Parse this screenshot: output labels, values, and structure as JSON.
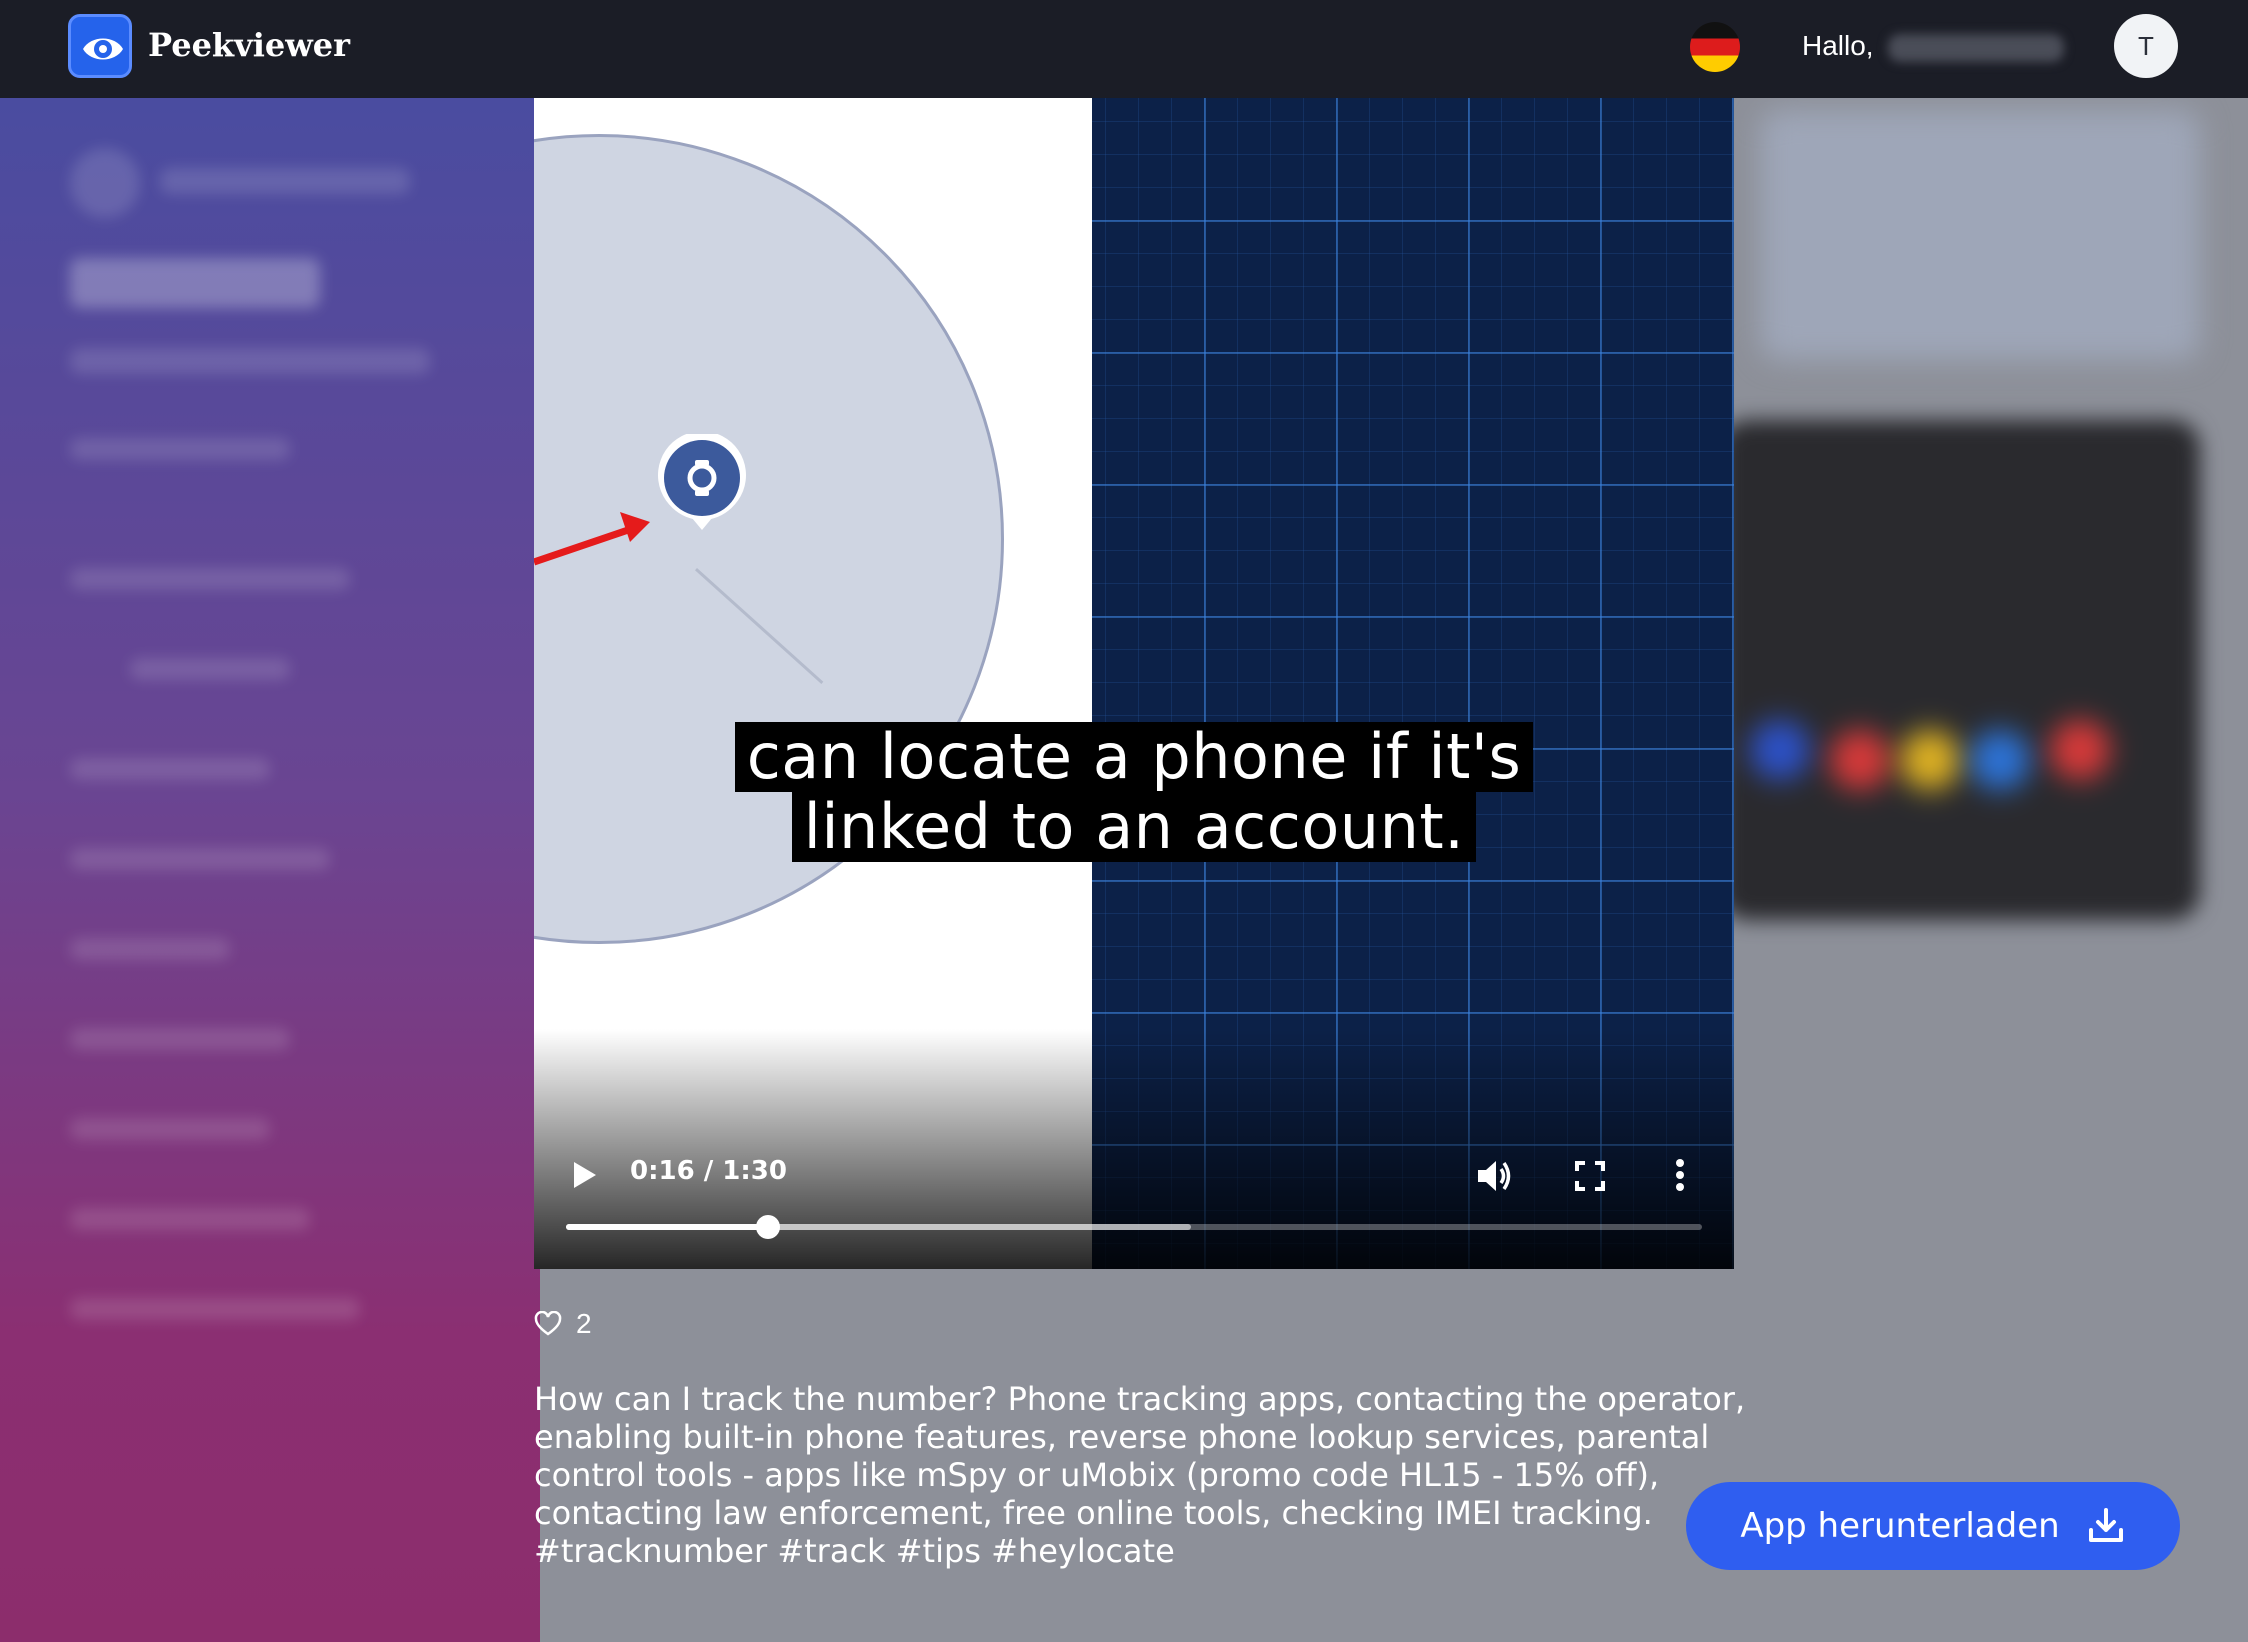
{
  "header": {
    "brand": "Peekviewer",
    "greeting": "Hallo,",
    "avatar_initial": "T",
    "language_flag": "de-flag-icon"
  },
  "video": {
    "caption_lines": [
      "can locate a phone if it's",
      "linked to an account."
    ],
    "time": "0:16 / 1:30",
    "progress_percent": 17.8,
    "buffered_percent": 55,
    "controls": [
      "play-icon",
      "volume-icon",
      "fullscreen-icon",
      "more-vert-icon"
    ]
  },
  "post": {
    "likes": "2",
    "description": "How can I track the number? Phone tracking apps, contacting the operator, enabling built-in phone features, reverse phone lookup services, parental control tools - apps like mSpy or uMobix (promo code HL15 - 15% off), contacting law enforcement, free online tools, checking IMEI tracking. #tracknumber #track #tips #heylocate"
  },
  "cta": {
    "download_label": "App herunterladen"
  },
  "colors": {
    "topbar": "#1b1d26",
    "accent": "#2f5ef0",
    "logo": "#2563eb"
  }
}
